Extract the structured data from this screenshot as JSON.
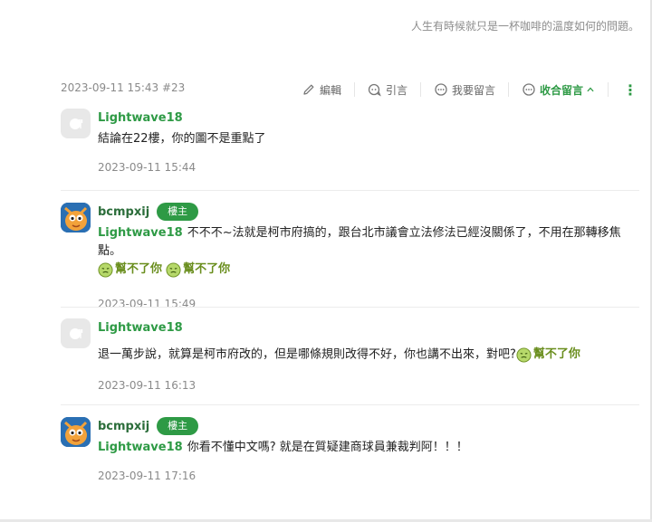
{
  "signature": "人生有時候就只是一杯咖啡的溫度如何的問題。",
  "post": {
    "meta": "2023-09-11 15:43 #23",
    "actions": {
      "edit": "編輯",
      "quote": "引言",
      "reply": "我要留言",
      "collapse": "收合留言"
    },
    "more_icon": "more-vertical-icon"
  },
  "comments": [
    {
      "user": "Lightwave18",
      "avatar": "default",
      "text": "結論在22樓，你的圖不是重點了",
      "time": "2023-09-11 15:44"
    },
    {
      "user": "bcmpxij",
      "badge": "樓主",
      "avatar": "mascot",
      "mention": "Lightwave18",
      "text": "不不不~法就是柯市府搞的，跟台北市議會立法修法已經沒關係了，不用在那轉移焦點。",
      "stickers": [
        "幫不了你",
        "幫不了你"
      ],
      "time": "2023-09-11 15:49"
    },
    {
      "user": "Lightwave18",
      "avatar": "default",
      "text": "退一萬步說，就算是柯市府改的，但是哪條規則改得不好，你也講不出來，對吧?",
      "stickers": [
        "幫不了你"
      ],
      "time": "2023-09-11 16:13"
    },
    {
      "user": "bcmpxij",
      "badge": "樓主",
      "avatar": "mascot",
      "mention": "Lightwave18",
      "text": "你看不懂中文嗎? 就是在質疑建商球員兼裁判阿！！！",
      "time": "2023-09-11 17:16"
    }
  ],
  "colors": {
    "accent": "#2e9a45",
    "muted": "#8a8a8a",
    "divider": "#ececec"
  }
}
